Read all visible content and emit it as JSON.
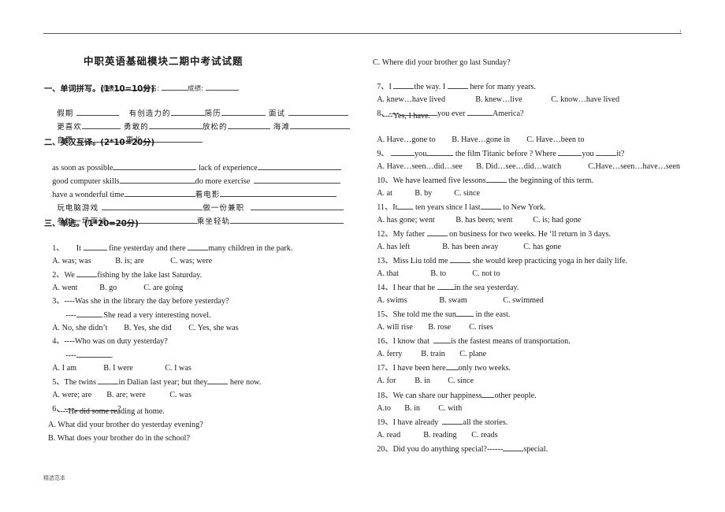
{
  "header": {
    "title": "中职英语基础模块二期中考试试题",
    "fields": {
      "class_label": "班级:",
      "name_label": "姓名:",
      "score_label": "成绩:"
    }
  },
  "section1": {
    "heading": "一、单词拼写。(1*10=10分)",
    "rows": [
      [
        "假期",
        "有创造力的",
        "简历",
        "面试"
      ],
      [
        "更喜欢",
        "勇敢的",
        "放松的",
        "海滩"
      ],
      [
        "自愿",
        "事业"
      ]
    ]
  },
  "section2": {
    "heading": "二、英汉互译。(2*10=20分)",
    "rows": [
      [
        "as soon as possible",
        "lack of experience"
      ],
      [
        "good computer skills",
        "do more exercise"
      ],
      [
        "have a wonderful time",
        "看电影"
      ],
      [
        "玩电脑游戏",
        "做一份兼职"
      ],
      [
        "参加一场面试",
        "乘坐轻轨"
      ]
    ]
  },
  "section3": {
    "heading": "三、单选。(1*20=20分)",
    "questions": [
      {
        "num": "1、",
        "stem_a": "It ",
        "stem_b": " fine yesterday and there ",
        "stem_c": "many children in the park.",
        "options": [
          "A. was; was",
          "B. is; are",
          "C. was; were"
        ]
      },
      {
        "num": "2、",
        "stem_a": "We ",
        "stem_b": "fishing by the lake last Saturday.",
        "options": [
          "A. went",
          "B. go",
          "C. are going"
        ]
      },
      {
        "num": "3、",
        "stem_a": "----Was she in the library the day before yesterday?",
        "reply_a": "----",
        "reply_b": ".She read a very interesting novel.",
        "options": [
          "A. No, she didn’t",
          "B. Yes, she did",
          "C. Yes, she was"
        ]
      },
      {
        "num": "4、",
        "stem_a": "----Who was on duty yesterday?",
        "reply_a": "----",
        "reply_b": ".",
        "options": [
          "A. I am",
          "B. I were",
          "C. I was"
        ]
      },
      {
        "num": "5、",
        "stem_a": "The twins ",
        "stem_b": "in Dalian last year; but they",
        "stem_c": " here now.",
        "options": [
          "A. were; are",
          "B. are; were",
          "C. was"
        ]
      },
      {
        "num": "6、",
        "stem_a": "----",
        "stem_b": "?",
        "reply": "----He did some reading at home.",
        "options": [
          "A. What did your brother do yesterday evening?",
          "B. What does your brother do in the school?",
          "C. Where did your brother go last Sunday?"
        ]
      },
      {
        "num": "7、",
        "stem_a": "I ",
        "stem_b": "the way. I ",
        "stem_c": " here for many years.",
        "options": [
          "A. knew…have lived",
          "B. knew…live",
          "C. know…have lived"
        ]
      },
      {
        "num": "8、",
        "stem_a": "----",
        "stem_b": "you ever ",
        "stem_c": "America?",
        "reply": "----Yes, I have.",
        "options": [
          "A. Have…gone to",
          "B. Have…gone in",
          "C. Have…been to"
        ]
      },
      {
        "num": "9、",
        "stem_a": "",
        "stem_b": "you",
        "stem_c": " the film Titanic before ? Where ",
        "stem_d": "you ",
        "stem_e": "it?",
        "options": [
          "A. Have…seen…did…see",
          "B. Did…see…did…watch",
          "C.Have…seen…have…seen"
        ]
      },
      {
        "num": "10、",
        "stem_a": "We have learned five lessons",
        "stem_b": " the beginning of this term.",
        "options": [
          "A. at",
          "B. by",
          "C. since"
        ]
      },
      {
        "num": "11、",
        "stem_a": "It",
        "stem_b": " ten years since I last",
        "stem_c": " to New York.",
        "options": [
          "A. has gone; went",
          "B. has been; went",
          "C. is; had gone"
        ]
      },
      {
        "num": "12、",
        "stem_a": "My father ",
        "stem_b": " on business for two weeks. He ‘ll return in 3 days.",
        "options": [
          "A. has left",
          "B. has been away",
          "C. has gone"
        ]
      },
      {
        "num": "13、",
        "stem_a": "Miss Liu told me ",
        "stem_b": " she would keep practicing yoga in her daily life.",
        "options": [
          "A. that",
          "B. to",
          "C. not to"
        ]
      },
      {
        "num": "14、",
        "stem_a": "I hear that he ",
        "stem_b": "in the sea yesterday.",
        "options": [
          "A. swims",
          "B. swam",
          "C. swimmed"
        ]
      },
      {
        "num": "15、",
        "stem_a": "She told me the sun",
        "stem_b": " in the east.",
        "options": [
          "A. will rise",
          "B. rose",
          "C. rises"
        ]
      },
      {
        "num": "16、",
        "stem_a": "I know that  ",
        "stem_b": "is the fastest means of transportation.",
        "options": [
          "A. ferry",
          "B. train",
          "C. plane"
        ]
      },
      {
        "num": "17、",
        "stem_a": "I have been here",
        "stem_b": "only two weeks.",
        "options": [
          "A. for",
          "B. in",
          "C. since"
        ]
      },
      {
        "num": "18、",
        "stem_a": "We can share our happiness",
        "stem_b": "other people.",
        "options": [
          "A.to",
          "B. in",
          "C. with"
        ]
      },
      {
        "num": "19、",
        "stem_a": "I have already  ",
        "stem_b": "all the stories.",
        "options": [
          "A. read",
          "B. reading",
          "C. reads"
        ]
      },
      {
        "num": "20、",
        "stem_a": "Did you do anything special?------",
        "stem_b": "special.",
        "options": []
      }
    ]
  },
  "footer": {
    "text": "精选范本"
  }
}
